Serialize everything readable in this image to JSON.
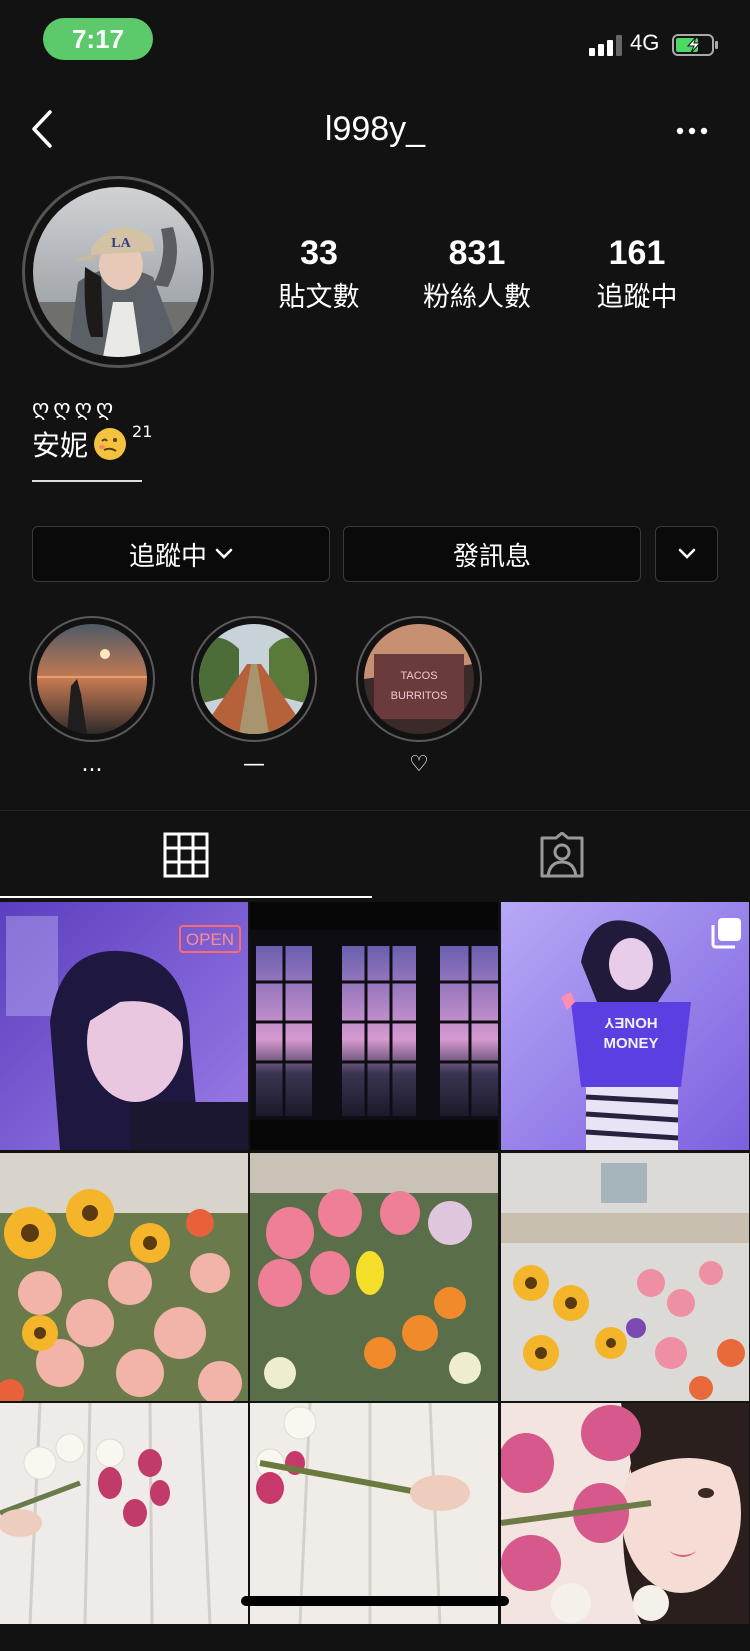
{
  "status_bar": {
    "time": "7:17",
    "network": "4G"
  },
  "header": {
    "username": "l998y_"
  },
  "stats": [
    {
      "value": "33",
      "label": "貼文數"
    },
    {
      "value": "831",
      "label": "粉絲人數"
    },
    {
      "value": "161",
      "label": "追蹤中"
    }
  ],
  "bio": {
    "symbols": "ღღღღ",
    "name": "安妮",
    "superscript": "21"
  },
  "actions": {
    "following": "追蹤中",
    "message": "發訊息"
  },
  "highlights": [
    {
      "label": "..."
    },
    {
      "label": "—"
    },
    {
      "label": "♡"
    }
  ],
  "highlight_sign": {
    "line1": "TACOS",
    "line2": "BURRITOS"
  },
  "posts": {
    "open_sign": "OPEN",
    "shirt_line1": "HONEY",
    "shirt_line2": "MONEY"
  }
}
